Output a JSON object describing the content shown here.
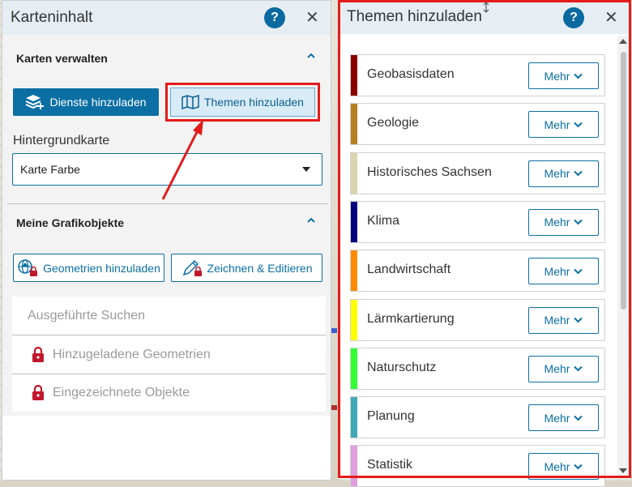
{
  "left_panel": {
    "title": "Karteninhalt",
    "help_label": "?",
    "close_label": "✕",
    "section_manage": {
      "title": "Karten verwalten",
      "add_services_label": "Dienste hinzuladen",
      "add_themes_label": "Themen hinzuladen",
      "background_label": "Hintergrundkarte",
      "background_value": "Karte Farbe"
    },
    "section_graphics": {
      "title": "Meine Grafikobjekte",
      "add_geometries_label": "Geometrien hinzuladen",
      "draw_edit_label": "Zeichnen & Editieren"
    },
    "list": [
      {
        "label": "Ausgeführte Suchen",
        "locked": false
      },
      {
        "label": "Hinzugeladene Geometrien",
        "locked": true
      },
      {
        "label": "Eingezeichnete Objekte",
        "locked": true
      }
    ]
  },
  "right_panel": {
    "title": "Themen hinzuladen",
    "help_label": "?",
    "close_label": "✕",
    "more_label": "Mehr",
    "themes": [
      {
        "label": "Geobasisdaten",
        "color": "#8b0000"
      },
      {
        "label": "Geologie",
        "color": "#b57f22"
      },
      {
        "label": "Historisches Sachsen",
        "color": "#dcd4ae"
      },
      {
        "label": "Klima",
        "color": "#000080"
      },
      {
        "label": "Landwirtschaft",
        "color": "#ff8c00"
      },
      {
        "label": "Lärmkartierung",
        "color": "#ffff00"
      },
      {
        "label": "Naturschutz",
        "color": "#33ff33"
      },
      {
        "label": "Planung",
        "color": "#3fa9b8"
      },
      {
        "label": "Statistik",
        "color": "#dda0dd"
      }
    ]
  },
  "colors": {
    "accent": "#0b6fa4",
    "highlight": "#e41b1b"
  }
}
